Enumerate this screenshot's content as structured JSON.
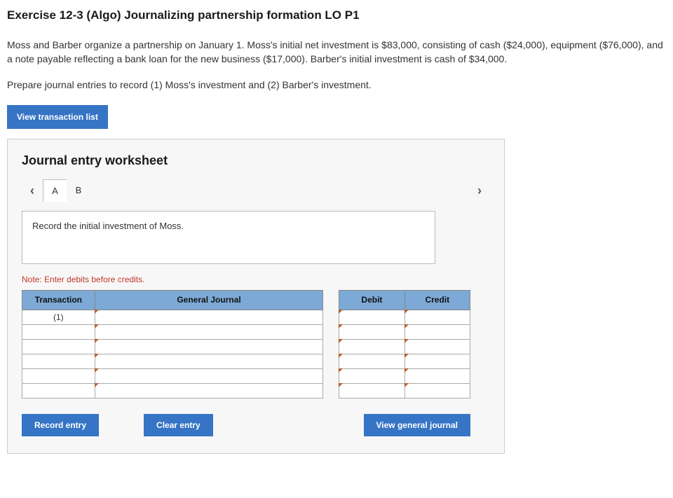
{
  "header": {
    "title": "Exercise 12-3 (Algo) Journalizing partnership formation LO P1"
  },
  "problem": {
    "text": "Moss and Barber organize a partnership on January 1. Moss's initial net investment is $83,000, consisting of cash ($24,000), equipment ($76,000), and a note payable reflecting a bank loan for the new business ($17,000). Barber's initial investment is cash of $34,000.",
    "instruction": "Prepare journal entries to record (1) Moss's investment and (2) Barber's investment."
  },
  "buttons": {
    "view_transaction_list": "View transaction list",
    "record_entry": "Record entry",
    "clear_entry": "Clear entry",
    "view_general_journal": "View general journal"
  },
  "worksheet": {
    "title": "Journal entry worksheet",
    "tabs": {
      "a": "A",
      "b": "B"
    },
    "prompt": "Record the initial investment of Moss.",
    "note": "Note: Enter debits before credits.",
    "columns": {
      "transaction": "Transaction",
      "general_journal": "General Journal",
      "debit": "Debit",
      "credit": "Credit"
    },
    "rows": [
      {
        "transaction": "(1)",
        "gj": "",
        "debit": "",
        "credit": ""
      },
      {
        "transaction": "",
        "gj": "",
        "debit": "",
        "credit": ""
      },
      {
        "transaction": "",
        "gj": "",
        "debit": "",
        "credit": ""
      },
      {
        "transaction": "",
        "gj": "",
        "debit": "",
        "credit": ""
      },
      {
        "transaction": "",
        "gj": "",
        "debit": "",
        "credit": ""
      },
      {
        "transaction": "",
        "gj": "",
        "debit": "",
        "credit": ""
      }
    ]
  }
}
